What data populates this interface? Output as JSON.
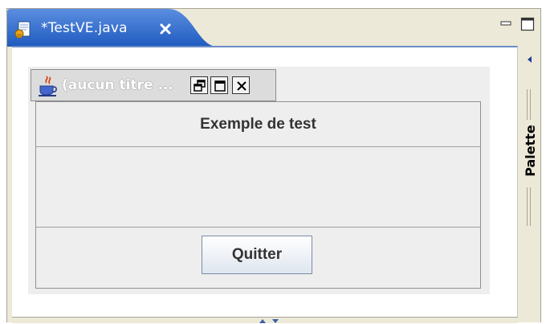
{
  "editor": {
    "tab": {
      "title": "*TestVE.java",
      "icon": "java-file-icon",
      "close_icon": "close-icon"
    },
    "window_controls": {
      "minimize_icon": "minimize-icon",
      "maximize_icon": "maximize-icon"
    },
    "palette": {
      "label": "Palette",
      "collapse_icon": "triangle-left-icon"
    }
  },
  "jframe": {
    "title": "(aucun titre ...",
    "icon": "java-cup-icon",
    "buttons": [
      "restore-icon",
      "maximize-icon",
      "close-icon"
    ],
    "header_label": "Exemple de test",
    "quit_button": "Quitter"
  },
  "colors": {
    "tab_active": "#1f5bbf",
    "tab_active_light": "#5b8ee0",
    "editor_border": "#6b8dc6",
    "frame_bg": "#eeeeee",
    "chrome_bg": "#ece9d8"
  }
}
